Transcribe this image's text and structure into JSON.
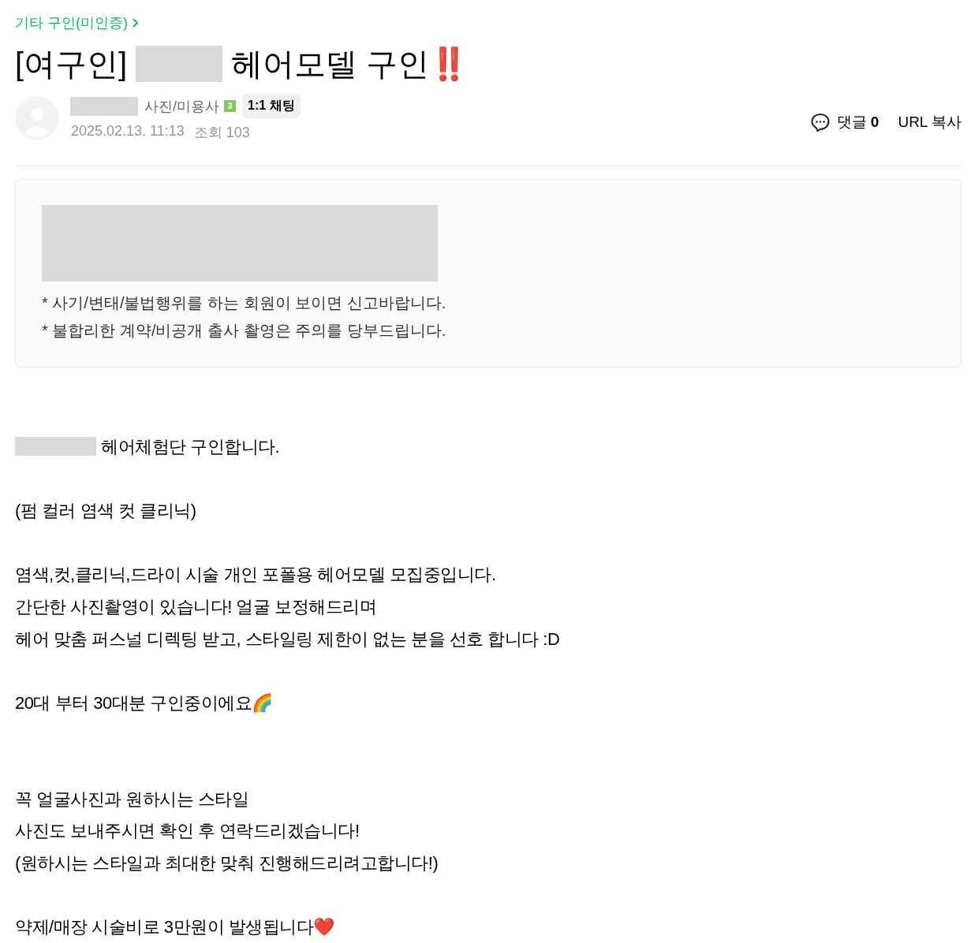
{
  "breadcrumb": {
    "label": "기타 구인(미인증)"
  },
  "title": {
    "segments": [
      {
        "kind": "text",
        "text": "[여구인]"
      },
      {
        "kind": "redacted"
      },
      {
        "kind": "text",
        "text": "헤어모델 구인‼️"
      }
    ]
  },
  "author": {
    "name_redacted": true,
    "role": "사진/미용사",
    "level": "3",
    "chat_button": "1:1 채팅",
    "date": "2025.02.13. 11:13",
    "views": "조회 103"
  },
  "actions": {
    "comments": "댓글 **0**",
    "copy_url": "URL 복사"
  },
  "notice": {
    "redacted_block": true,
    "lines": [
      "* 사기/변태/불법행위를 하는 회원이 보이면 신고바랍니다.",
      "* 불합리한 계약/비공개 출사 촬영은 주의를 당부드립니다."
    ]
  },
  "body": [
    {
      "kind": "line",
      "segments": [
        {
          "kind": "redacted"
        },
        {
          "kind": "text",
          "text": "헤어체험단 구인합니다."
        }
      ]
    },
    {
      "kind": "blank"
    },
    {
      "kind": "line",
      "segments": [
        {
          "kind": "text",
          "text": "(펌 컬러 염색 컷 클리닉)"
        }
      ]
    },
    {
      "kind": "blank"
    },
    {
      "kind": "line",
      "segments": [
        {
          "kind": "text",
          "text": "염색,컷,클리닉,드라이 시술 개인 포폴용 헤어모델 모집중입니다."
        }
      ]
    },
    {
      "kind": "line",
      "segments": [
        {
          "kind": "text",
          "text": "간단한 사진촬영이 있습니다! 얼굴 보정해드리며"
        }
      ]
    },
    {
      "kind": "line",
      "segments": [
        {
          "kind": "text",
          "text": "헤어 맞춤 퍼스널 디렉팅 받고, 스타일링 제한이 없는 분을 선호 합니다 :D"
        }
      ]
    },
    {
      "kind": "blank"
    },
    {
      "kind": "line",
      "segments": [
        {
          "kind": "text",
          "text": "20대 부터 30대분 구인중이에요🌈"
        }
      ]
    },
    {
      "kind": "blank"
    },
    {
      "kind": "blank"
    },
    {
      "kind": "line",
      "segments": [
        {
          "kind": "text",
          "text": "꼭 얼굴사진과 원하시는 스타일"
        }
      ]
    },
    {
      "kind": "line",
      "segments": [
        {
          "kind": "text",
          "text": "사진도 보내주시면 확인 후 연락드리겠습니다!"
        }
      ]
    },
    {
      "kind": "line",
      "segments": [
        {
          "kind": "text",
          "text": "(원하시는 스타일과 최대한 맞춰 진행해드리려고합니다!)"
        }
      ]
    },
    {
      "kind": "blank"
    },
    {
      "kind": "line",
      "segments": [
        {
          "kind": "text",
          "text": "약제/매장 시술비로 3만원이 발생됩니다❤️"
        }
      ]
    }
  ]
}
